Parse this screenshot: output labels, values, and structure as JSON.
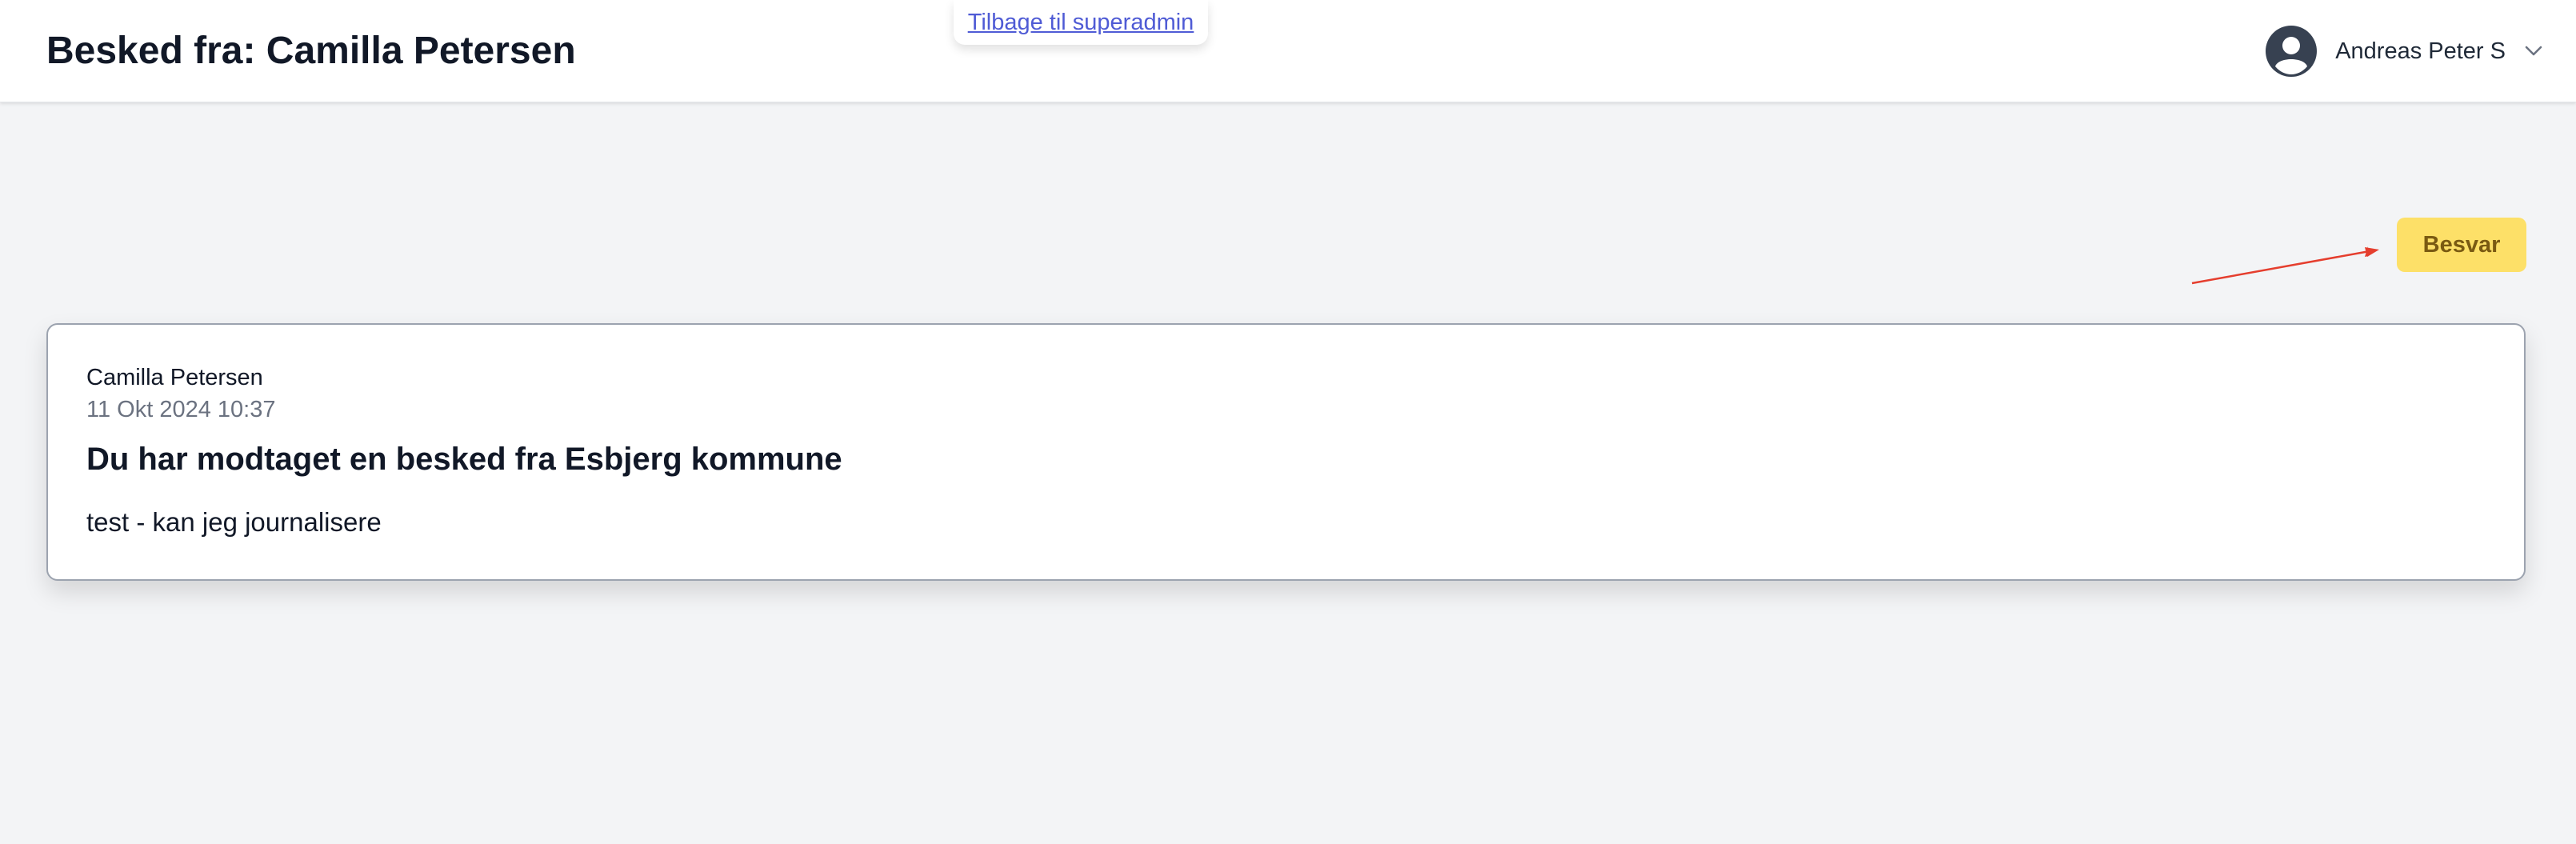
{
  "header": {
    "title": "Besked fra: Camilla Petersen",
    "superadmin_link": "Tilbage til superadmin",
    "user_name": "Andreas Peter S"
  },
  "actions": {
    "reply_label": "Besvar"
  },
  "message": {
    "sender": "Camilla Petersen",
    "timestamp": "11 Okt 2024 10:37",
    "subject": "Du har modtaget en besked fra Esbjerg kommune",
    "body": "test - kan jeg journalisere"
  },
  "colors": {
    "background": "#f3f4f6",
    "header": "#ffffff",
    "link": "#4f5bd5",
    "reply_button": "#fde068",
    "reply_text": "#7a5a12",
    "annotation_arrow": "#e53e2e"
  },
  "icons": {
    "avatar": "user-circle-icon",
    "dropdown": "chevron-down-icon"
  }
}
